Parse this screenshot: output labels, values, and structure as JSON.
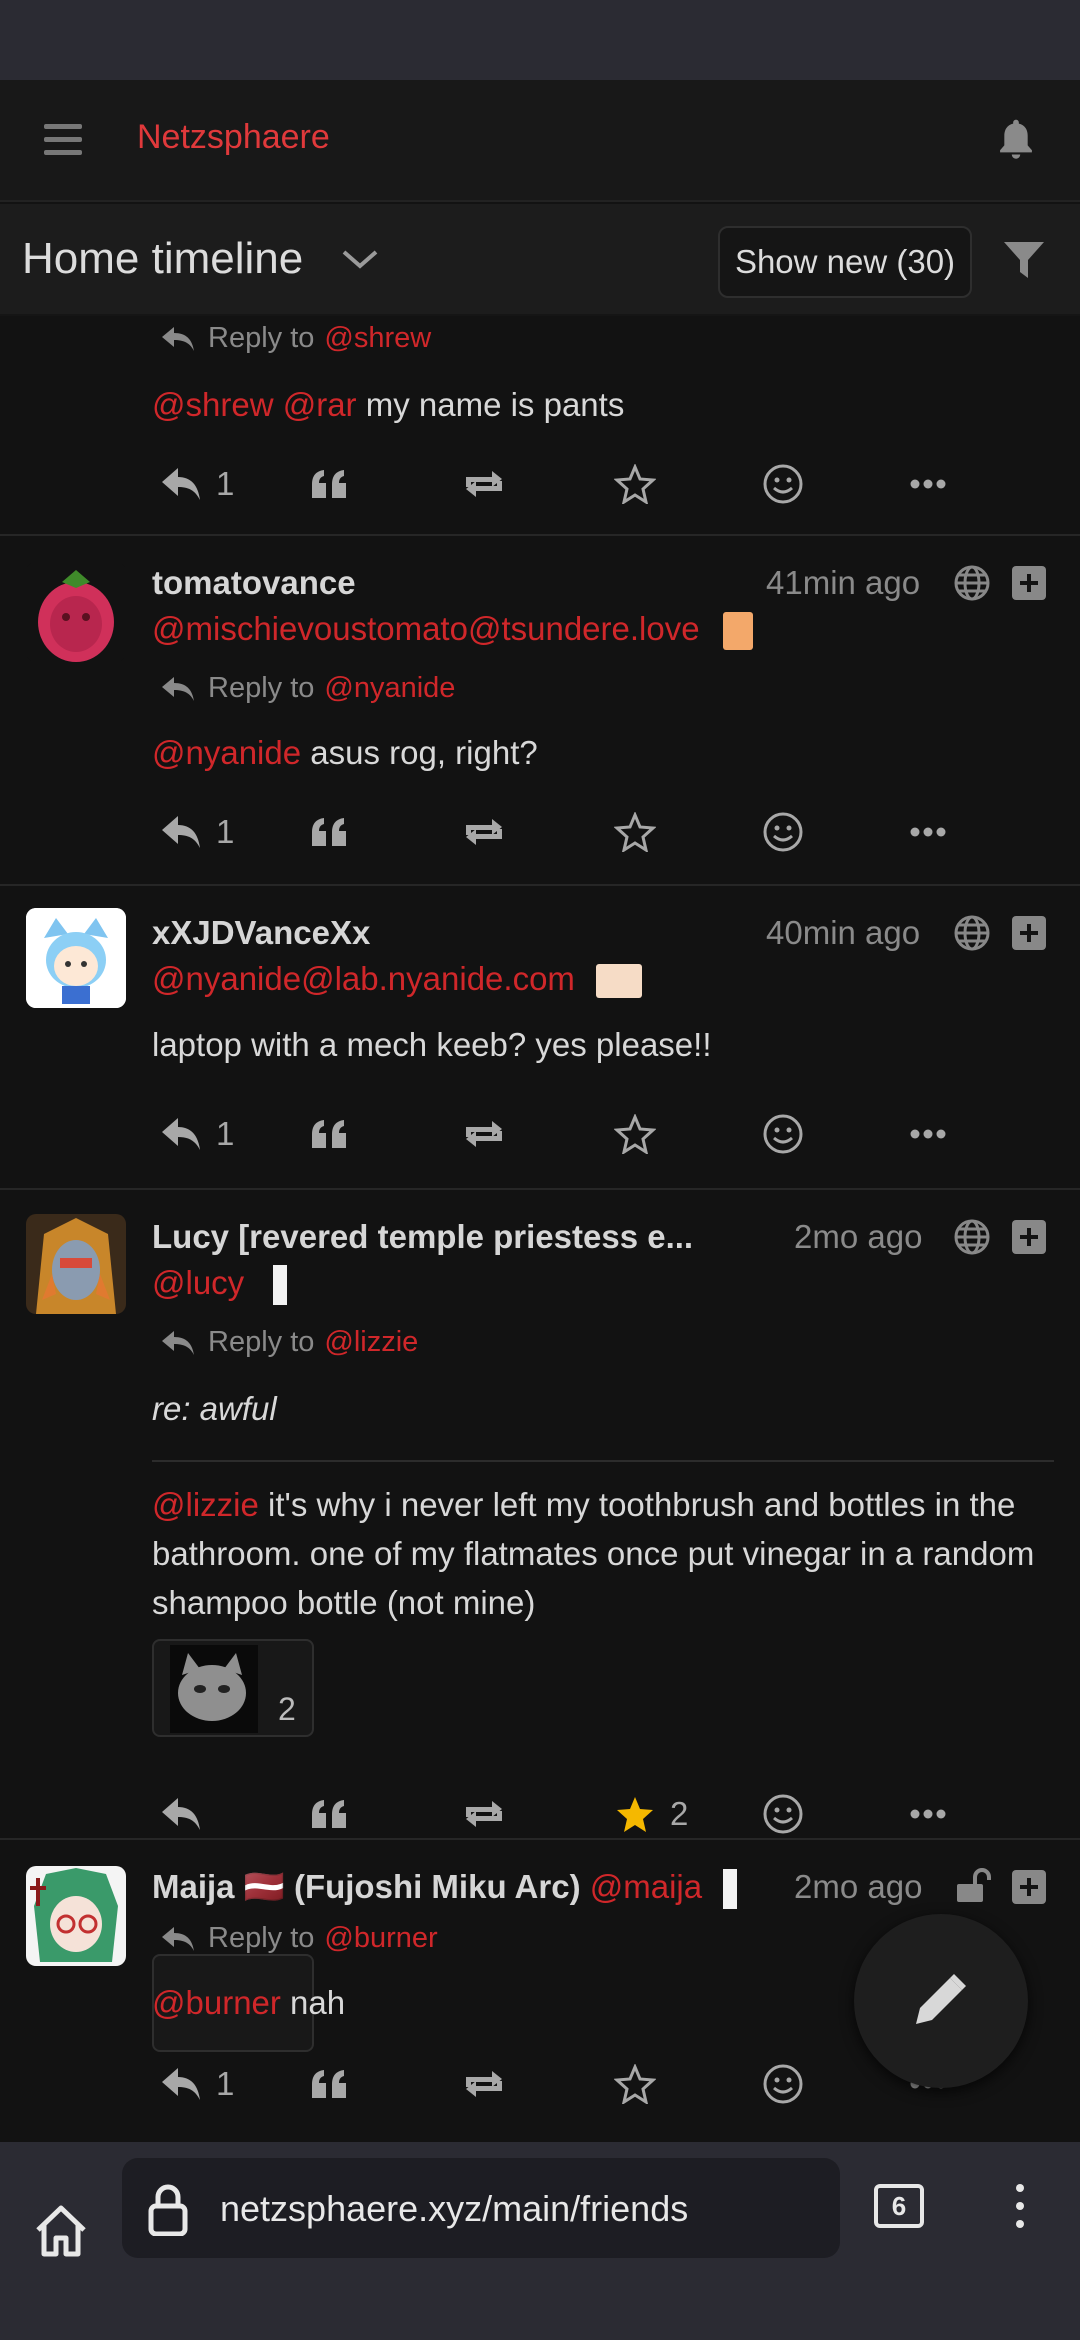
{
  "app": {
    "brand": "Netzsphaere",
    "accent_color": "#d0272a"
  },
  "timeline": {
    "title": "Home timeline",
    "show_new_label": "Show new (30)"
  },
  "statuses": [
    {
      "reply_label": "Reply to",
      "reply_to": "@shrew",
      "content_mentions": [
        "@shrew",
        "@rar"
      ],
      "content_text": " my name is pants",
      "reply_count": "1"
    },
    {
      "name": "tomatovance",
      "acct": "@mischievoustomato@tsundere.love",
      "time": "41min ago",
      "reply_label": "Reply to",
      "reply_to": "@nyanide",
      "content_mention": "@nyanide",
      "content_text": " asus rog, right?",
      "reply_count": "1"
    },
    {
      "name": "xXJDVanceXx",
      "acct": "@nyanide@lab.nyanide.com",
      "time": "40min ago",
      "content_text": "laptop with a mech keeb? yes please!!",
      "reply_count": "1"
    },
    {
      "name": "Lucy [revered temple priestess e...",
      "acct": "@lucy",
      "time": "2mo ago",
      "reply_label": "Reply to",
      "reply_to": "@lizzie",
      "subject": "re: awful",
      "content_mention": "@lizzie",
      "content_text": " it's why i never left my toothbrush and bottles in the bathroom. one of my flatmates once put vinegar in a random shampoo bottle (not mine)",
      "attachment_count": "2",
      "favorite_count": "2"
    },
    {
      "name": "Maija 🇱🇻 (Fujoshi Miku Arc)",
      "acct": "@maija",
      "time": "2mo ago",
      "reply_label": "Reply to",
      "reply_to": "@burner",
      "content_mention": "@burner",
      "content_text": " nah",
      "reply_count": "1"
    }
  ],
  "browser": {
    "url": "netzsphaere.xyz/main/friends",
    "tab_count": "6"
  }
}
